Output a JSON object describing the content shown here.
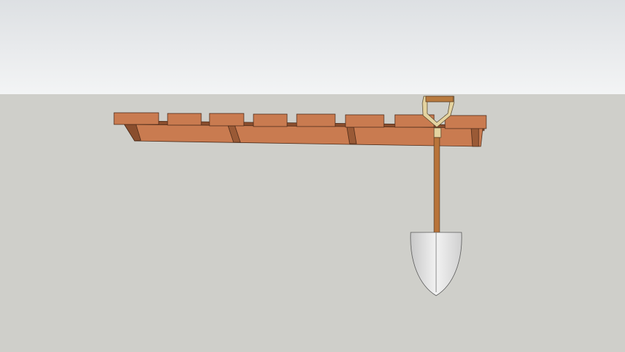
{
  "scene": {
    "colors": {
      "sky_top": "#dde0e3",
      "sky_bottom": "#f3f4f5",
      "ground": "#cfcfca",
      "wood": "#c97b50",
      "wood_dark": "#8a4e2e",
      "shovel_blade": "#dcdcdc",
      "handle_grip": "#e4d3a0"
    }
  }
}
